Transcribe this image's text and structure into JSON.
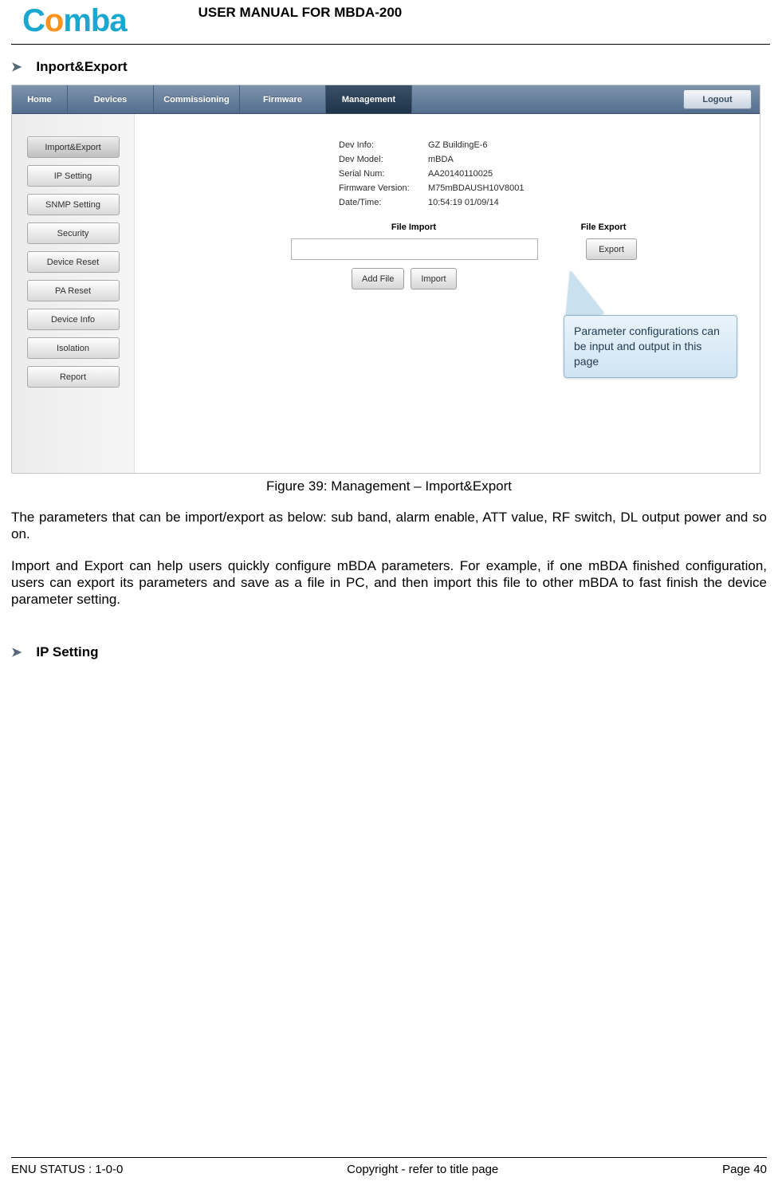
{
  "header": {
    "logo_c": "C",
    "logo_o": "o",
    "logo_rest": "mba",
    "title": "USER MANUAL FOR MBDA-200"
  },
  "section1_title": "Inport&Export",
  "nav": {
    "home": "Home",
    "devices": "Devices",
    "commissioning": "Commissioning",
    "firmware": "Firmware",
    "management": "Management",
    "logout": "Logout"
  },
  "sidebar": {
    "import_export": "Import&Export",
    "ip_setting": "IP Setting",
    "snmp_setting": "SNMP Setting",
    "security": "Security",
    "device_reset": "Device Reset",
    "pa_reset": "PA Reset",
    "device_info": "Device Info",
    "isolation": "Isolation",
    "report": "Report"
  },
  "info": {
    "dev_info_label": "Dev Info:",
    "dev_info_value": "GZ BuildingE-6",
    "dev_model_label": "Dev Model:",
    "dev_model_value": "mBDA",
    "serial_label": "Serial Num:",
    "serial_value": "AA20140110025",
    "fw_label": "Firmware Version:",
    "fw_value": "M75mBDAUSH10V8001",
    "dt_label": "Date/Time:",
    "dt_value": "10:54:19 01/09/14"
  },
  "columns": {
    "file_import": "File Import",
    "file_export": "File Export"
  },
  "buttons": {
    "export": "Export",
    "add_file": "Add File",
    "import": "Import"
  },
  "callout": "Parameter configurations can be input and output in this page",
  "caption": "Figure 39: Management – Import&Export",
  "para1": "The parameters that can be import/export as below: sub band, alarm enable, ATT value, RF switch, DL output power and so on.",
  "para2": "Import and Export can help users quickly configure mBDA parameters. For example, if one mBDA finished configuration, users can export its parameters and save as a file in PC, and then import this file to other mBDA to fast finish the device parameter setting.",
  "section2_title": "IP Setting",
  "footer": {
    "left": "ENU STATUS : 1-0-0",
    "center": "Copyright - refer to title page",
    "right": "Page 40"
  }
}
